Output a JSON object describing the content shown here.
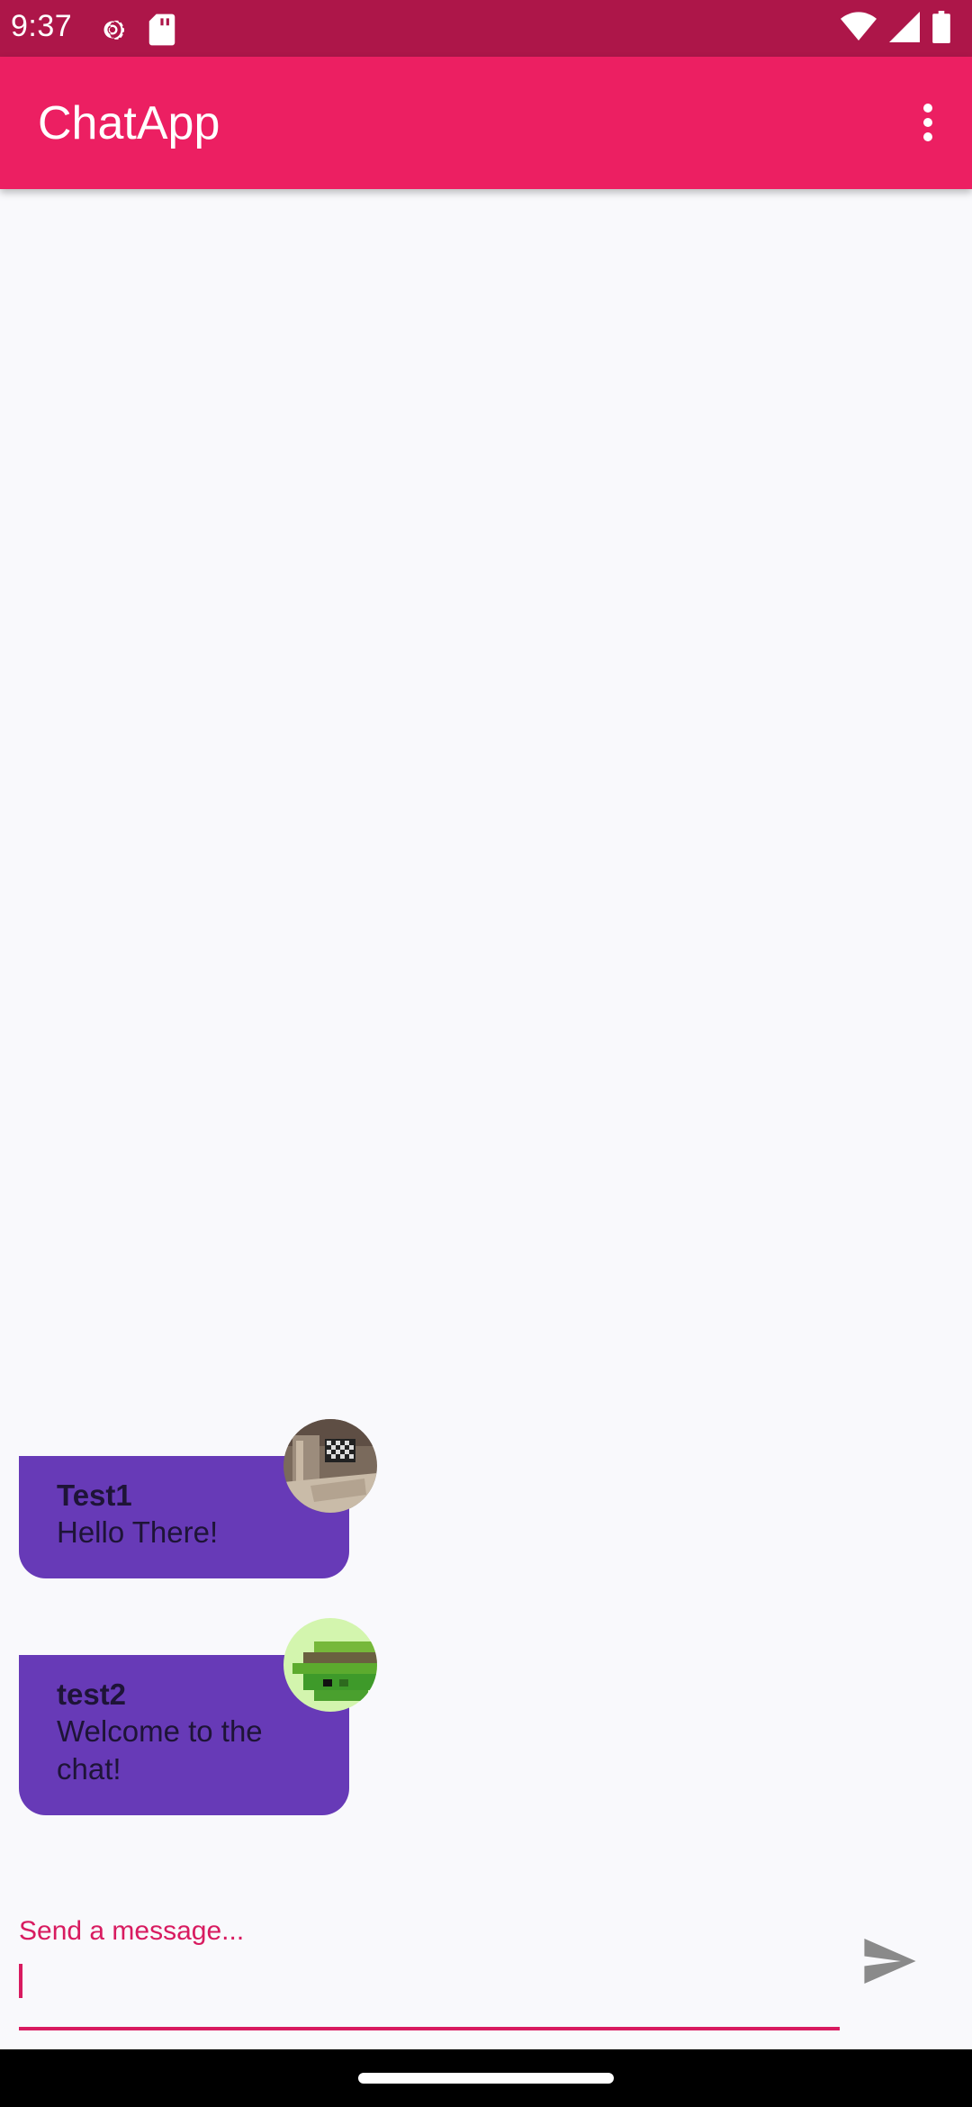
{
  "status_bar": {
    "time": "9:37",
    "icons": [
      "settings-icon",
      "sd-card-icon",
      "wifi-icon",
      "cell-signal-icon",
      "battery-icon"
    ]
  },
  "app_bar": {
    "title": "ChatApp",
    "menu_icon": "more-vert-icon"
  },
  "messages": [
    {
      "author": "Test1",
      "text": "Hello There!"
    },
    {
      "author": "test2",
      "text": "Welcome to the chat!"
    }
  ],
  "composer": {
    "hint": "Send a message...",
    "value": "",
    "send_icon": "send-icon"
  },
  "colors": {
    "status_bar": "#ad1649",
    "app_bar": "#ec1f62",
    "accent": "#d81b60",
    "bubble": "#673ab7",
    "background": "#f9f9fc"
  }
}
